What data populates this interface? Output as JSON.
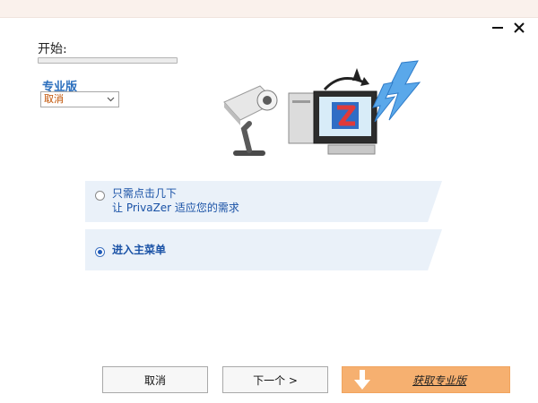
{
  "window": {
    "minimize_label": "—",
    "close_label": "✕"
  },
  "progress": {
    "label": "开始:",
    "fraction": 0.0
  },
  "pro_version": {
    "label": "专业版",
    "select_value": "取消"
  },
  "options": [
    {
      "line1": "只需点击几下",
      "line2": "让 PrivaZer 适应您的需求",
      "selected": false
    },
    {
      "line1": "进入主菜单",
      "selected": true
    }
  ],
  "buttons": {
    "cancel": "取消",
    "next": "下一个 >",
    "get_pro": "获取专业版"
  },
  "colors": {
    "accent_blue": "#2a6ebd",
    "get_pro_bg": "#f6b070",
    "option_bg": "#eaf1f9"
  }
}
